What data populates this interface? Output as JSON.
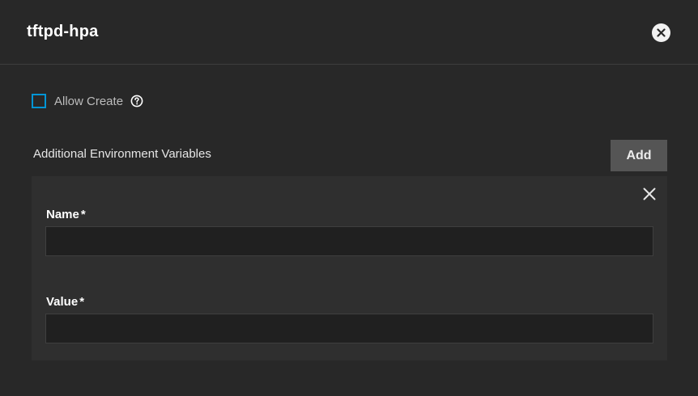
{
  "dialog": {
    "title": "tftpd-hpa",
    "close_icon": "close-circle-icon"
  },
  "allow_create": {
    "label": "Allow Create",
    "checked": false,
    "help_icon": "help-circle-icon"
  },
  "env_vars": {
    "section_label": "Additional Environment Variables",
    "add_label": "Add",
    "items": [
      {
        "remove_icon": "close-icon",
        "name_label": "Name",
        "name_value": "",
        "value_label": "Value",
        "value_value": "",
        "required_marker": "*"
      }
    ]
  },
  "colors": {
    "background": "#282828",
    "accent": "#0095d5",
    "button_bg": "#555555",
    "card_bg": "#2f2f2f",
    "input_bg": "#202020"
  }
}
